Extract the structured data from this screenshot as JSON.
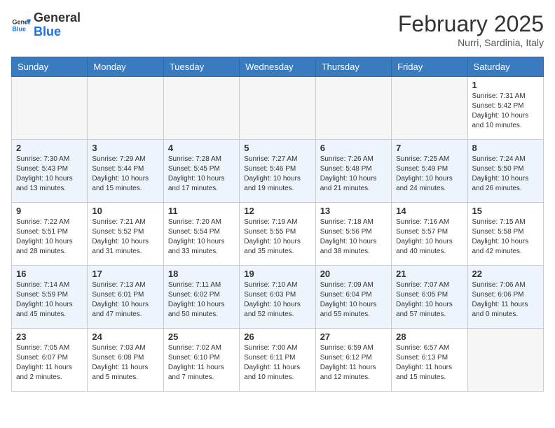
{
  "header": {
    "logo_general": "General",
    "logo_blue": "Blue",
    "month_title": "February 2025",
    "location": "Nurri, Sardinia, Italy"
  },
  "days_of_week": [
    "Sunday",
    "Monday",
    "Tuesday",
    "Wednesday",
    "Thursday",
    "Friday",
    "Saturday"
  ],
  "weeks": [
    {
      "days": [
        {
          "num": "",
          "info": ""
        },
        {
          "num": "",
          "info": ""
        },
        {
          "num": "",
          "info": ""
        },
        {
          "num": "",
          "info": ""
        },
        {
          "num": "",
          "info": ""
        },
        {
          "num": "",
          "info": ""
        },
        {
          "num": "1",
          "info": "Sunrise: 7:31 AM\nSunset: 5:42 PM\nDaylight: 10 hours and 10 minutes."
        }
      ]
    },
    {
      "days": [
        {
          "num": "2",
          "info": "Sunrise: 7:30 AM\nSunset: 5:43 PM\nDaylight: 10 hours and 13 minutes."
        },
        {
          "num": "3",
          "info": "Sunrise: 7:29 AM\nSunset: 5:44 PM\nDaylight: 10 hours and 15 minutes."
        },
        {
          "num": "4",
          "info": "Sunrise: 7:28 AM\nSunset: 5:45 PM\nDaylight: 10 hours and 17 minutes."
        },
        {
          "num": "5",
          "info": "Sunrise: 7:27 AM\nSunset: 5:46 PM\nDaylight: 10 hours and 19 minutes."
        },
        {
          "num": "6",
          "info": "Sunrise: 7:26 AM\nSunset: 5:48 PM\nDaylight: 10 hours and 21 minutes."
        },
        {
          "num": "7",
          "info": "Sunrise: 7:25 AM\nSunset: 5:49 PM\nDaylight: 10 hours and 24 minutes."
        },
        {
          "num": "8",
          "info": "Sunrise: 7:24 AM\nSunset: 5:50 PM\nDaylight: 10 hours and 26 minutes."
        }
      ]
    },
    {
      "days": [
        {
          "num": "9",
          "info": "Sunrise: 7:22 AM\nSunset: 5:51 PM\nDaylight: 10 hours and 28 minutes."
        },
        {
          "num": "10",
          "info": "Sunrise: 7:21 AM\nSunset: 5:52 PM\nDaylight: 10 hours and 31 minutes."
        },
        {
          "num": "11",
          "info": "Sunrise: 7:20 AM\nSunset: 5:54 PM\nDaylight: 10 hours and 33 minutes."
        },
        {
          "num": "12",
          "info": "Sunrise: 7:19 AM\nSunset: 5:55 PM\nDaylight: 10 hours and 35 minutes."
        },
        {
          "num": "13",
          "info": "Sunrise: 7:18 AM\nSunset: 5:56 PM\nDaylight: 10 hours and 38 minutes."
        },
        {
          "num": "14",
          "info": "Sunrise: 7:16 AM\nSunset: 5:57 PM\nDaylight: 10 hours and 40 minutes."
        },
        {
          "num": "15",
          "info": "Sunrise: 7:15 AM\nSunset: 5:58 PM\nDaylight: 10 hours and 42 minutes."
        }
      ]
    },
    {
      "days": [
        {
          "num": "16",
          "info": "Sunrise: 7:14 AM\nSunset: 5:59 PM\nDaylight: 10 hours and 45 minutes."
        },
        {
          "num": "17",
          "info": "Sunrise: 7:13 AM\nSunset: 6:01 PM\nDaylight: 10 hours and 47 minutes."
        },
        {
          "num": "18",
          "info": "Sunrise: 7:11 AM\nSunset: 6:02 PM\nDaylight: 10 hours and 50 minutes."
        },
        {
          "num": "19",
          "info": "Sunrise: 7:10 AM\nSunset: 6:03 PM\nDaylight: 10 hours and 52 minutes."
        },
        {
          "num": "20",
          "info": "Sunrise: 7:09 AM\nSunset: 6:04 PM\nDaylight: 10 hours and 55 minutes."
        },
        {
          "num": "21",
          "info": "Sunrise: 7:07 AM\nSunset: 6:05 PM\nDaylight: 10 hours and 57 minutes."
        },
        {
          "num": "22",
          "info": "Sunrise: 7:06 AM\nSunset: 6:06 PM\nDaylight: 11 hours and 0 minutes."
        }
      ]
    },
    {
      "days": [
        {
          "num": "23",
          "info": "Sunrise: 7:05 AM\nSunset: 6:07 PM\nDaylight: 11 hours and 2 minutes."
        },
        {
          "num": "24",
          "info": "Sunrise: 7:03 AM\nSunset: 6:08 PM\nDaylight: 11 hours and 5 minutes."
        },
        {
          "num": "25",
          "info": "Sunrise: 7:02 AM\nSunset: 6:10 PM\nDaylight: 11 hours and 7 minutes."
        },
        {
          "num": "26",
          "info": "Sunrise: 7:00 AM\nSunset: 6:11 PM\nDaylight: 11 hours and 10 minutes."
        },
        {
          "num": "27",
          "info": "Sunrise: 6:59 AM\nSunset: 6:12 PM\nDaylight: 11 hours and 12 minutes."
        },
        {
          "num": "28",
          "info": "Sunrise: 6:57 AM\nSunset: 6:13 PM\nDaylight: 11 hours and 15 minutes."
        },
        {
          "num": "",
          "info": ""
        }
      ]
    }
  ]
}
